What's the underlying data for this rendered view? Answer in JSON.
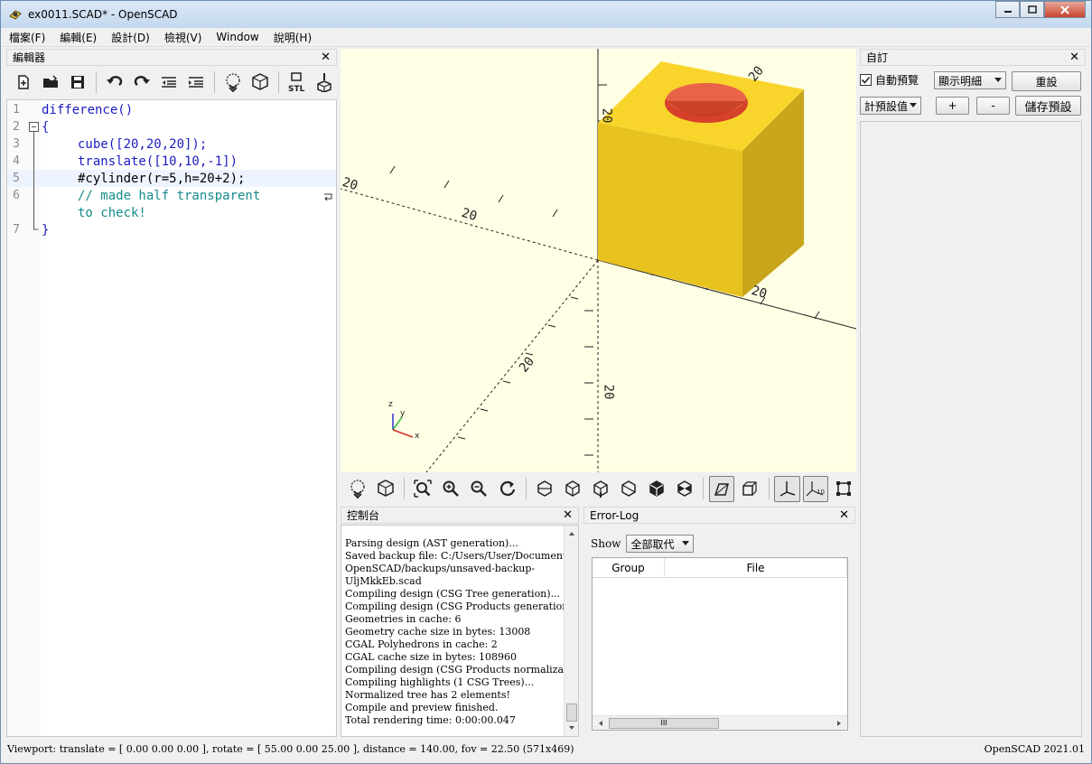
{
  "window": {
    "title": "ex0011.SCAD* - OpenSCAD"
  },
  "menu": [
    "檔案(F)",
    "編輯(E)",
    "設計(D)",
    "檢視(V)",
    "Window",
    "說明(H)"
  ],
  "editor": {
    "title": "編輯器",
    "lines": [
      {
        "num": "1",
        "text": "difference()"
      },
      {
        "num": "2",
        "text": "{"
      },
      {
        "num": "3",
        "text": "cube([20,20,20]);"
      },
      {
        "num": "4",
        "text": "translate([10,10,-1])"
      },
      {
        "num": "5",
        "text": "#cylinder(r=5,h=20+2);"
      },
      {
        "num": "6",
        "text": "// made half transparent"
      },
      {
        "num": "",
        "text": "to check!"
      },
      {
        "num": "7",
        "text": "}"
      }
    ]
  },
  "viewport": {
    "axis_labels": [
      "20",
      "20",
      "20",
      "20",
      "20",
      "20",
      "20"
    ],
    "gizmo": {
      "z": "z",
      "y": "y",
      "x": "x"
    },
    "colors": {
      "background": "#ffffe5",
      "cube_top": "#f9d52b",
      "cube_front": "#e8c21f",
      "cube_side": "#c8a51a",
      "hole": "#e04b2c"
    }
  },
  "console": {
    "title": "控制台",
    "lines": [
      "Parsing design (AST generation)...",
      "Saved backup file: C:/Users/User/Documents/",
      "OpenSCAD/backups/unsaved-backup-",
      "UljMkkEb.scad",
      "Compiling design (CSG Tree generation)...",
      "Compiling design (CSG Products generation)...",
      "Geometries in cache: 6",
      "Geometry cache size in bytes: 13008",
      "CGAL Polyhedrons in cache: 2",
      "CGAL cache size in bytes: 108960",
      "Compiling design (CSG Products normalization)...",
      "Compiling highlights (1 CSG Trees)...",
      "Normalized tree has 2 elements!",
      "Compile and preview finished.",
      "Total rendering time: 0:00:00.047"
    ]
  },
  "errorlog": {
    "title": "Error-Log",
    "show_label": "Show",
    "show_value": "全部取代",
    "col_group": "Group",
    "col_file": "File",
    "scroll_thumb": "III"
  },
  "customizer": {
    "title": "自訂",
    "auto_preview_label": "自動預覽",
    "auto_preview_checked": true,
    "detail_select": "顯示明細",
    "reset_button": "重設",
    "preset_select": "計預設值",
    "plus_button": "+",
    "minus_button": "-",
    "save_preset_button": "儲存預設"
  },
  "status": {
    "viewport": "Viewport: translate = [ 0.00 0.00 0.00 ], rotate = [ 55.00 0.00 25.00 ], distance = 140.00, fov = 22.50 (571x469)",
    "version": "OpenSCAD 2021.01"
  }
}
